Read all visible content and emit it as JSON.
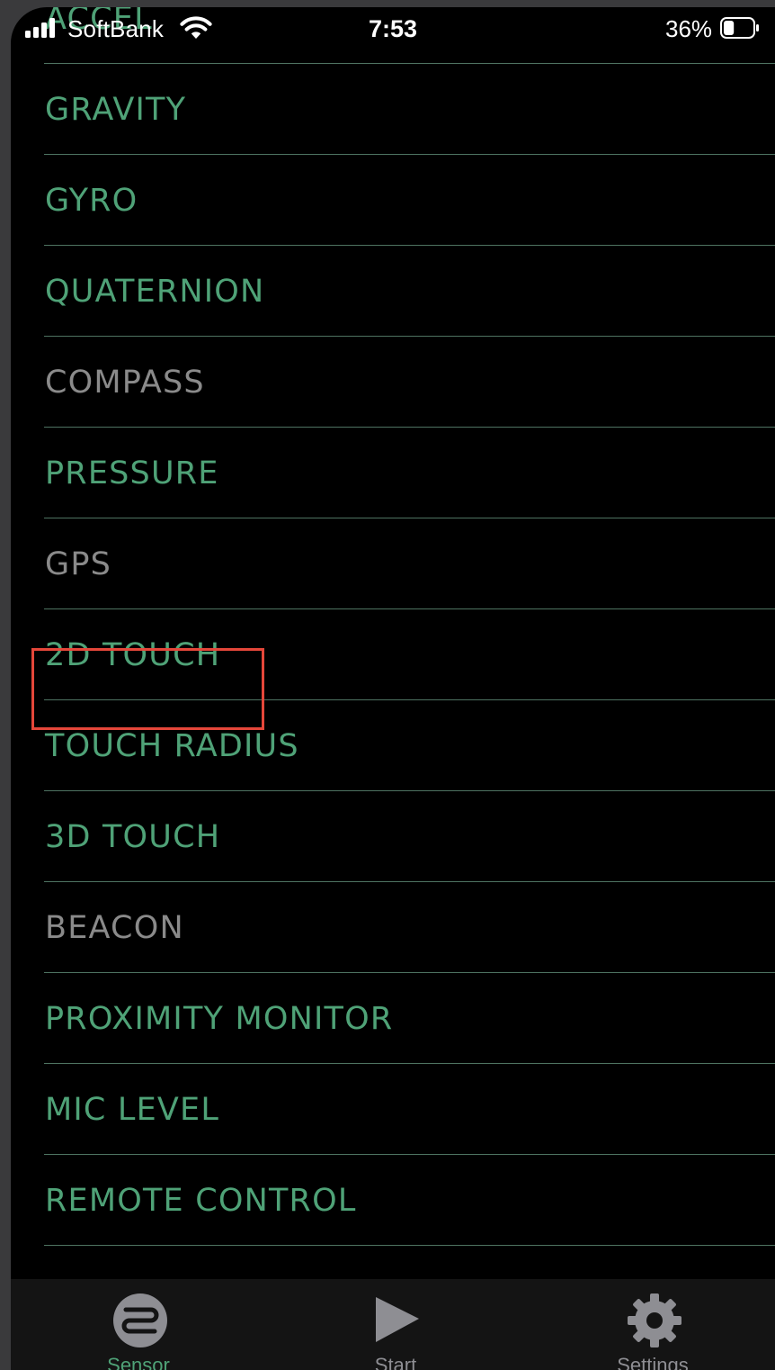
{
  "status_bar": {
    "carrier": "SoftBank",
    "time": "7:53",
    "battery_percent": "36%",
    "battery_level": 0.36
  },
  "colors": {
    "enabled_text": "#4fa277",
    "disabled_text": "#8a8a8a",
    "divider": "#4e7361",
    "highlight": "#e5473a",
    "tab_active": "#4fa277",
    "tab_inactive": "#8e8e93"
  },
  "sensors": {
    "items": [
      {
        "label": "ACCEL",
        "enabled": true
      },
      {
        "label": "GRAVITY",
        "enabled": true
      },
      {
        "label": "GYRO",
        "enabled": true
      },
      {
        "label": "QUATERNION",
        "enabled": true
      },
      {
        "label": "COMPASS",
        "enabled": false
      },
      {
        "label": "PRESSURE",
        "enabled": true
      },
      {
        "label": "GPS",
        "enabled": false
      },
      {
        "label": "2D TOUCH",
        "enabled": true,
        "highlighted": true
      },
      {
        "label": "TOUCH RADIUS",
        "enabled": true
      },
      {
        "label": "3D TOUCH",
        "enabled": true
      },
      {
        "label": "BEACON",
        "enabled": false
      },
      {
        "label": "PROXIMITY MONITOR",
        "enabled": true
      },
      {
        "label": "MIC LEVEL",
        "enabled": true
      },
      {
        "label": "REMOTE CONTROL",
        "enabled": true
      }
    ]
  },
  "tab_bar": {
    "tabs": [
      {
        "label": "Sensor",
        "icon": "sensor-icon",
        "active": true
      },
      {
        "label": "Start",
        "icon": "play-icon",
        "active": false
      },
      {
        "label": "Settings",
        "icon": "gear-icon",
        "active": false
      }
    ]
  }
}
